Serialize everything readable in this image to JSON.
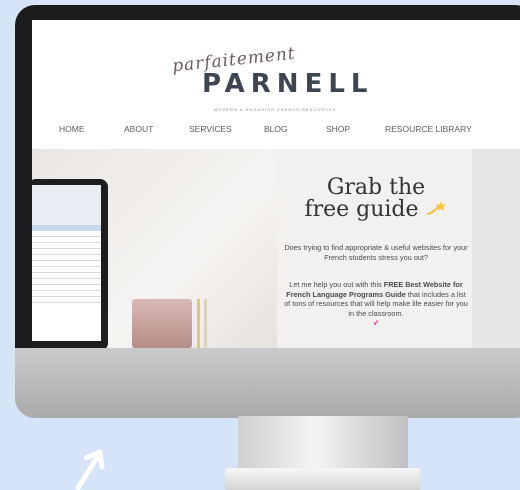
{
  "site": {
    "logo_script": "parfaitement",
    "logo_main": "PARNELL",
    "tagline": "MODERN & ENGAGING FRENCH RESOURCES"
  },
  "nav": {
    "items": [
      "HOME",
      "ABOUT",
      "SERVICES",
      "BLOG",
      "SHOP",
      "RESOURCE LIBRARY"
    ]
  },
  "hero": {
    "title_line1": "Grab the",
    "title_line2": "free guide",
    "title_icon": "sparkle-star-icon",
    "paragraph1": "Does trying to find appropriate & useful websites for your French students stress you out?",
    "paragraph2_pre": "Let me help you out with this ",
    "paragraph2_bold": "FREE Best Website for French Language Programs Guide",
    "paragraph2_post": " that includes a list of tons of resources that will help make life easier for you in the classroom.",
    "heart_icon": "heart-icon"
  },
  "colors": {
    "background": "#d6e4f7",
    "monitor_frame": "#1b1c1e",
    "logo": "#3d4550"
  }
}
